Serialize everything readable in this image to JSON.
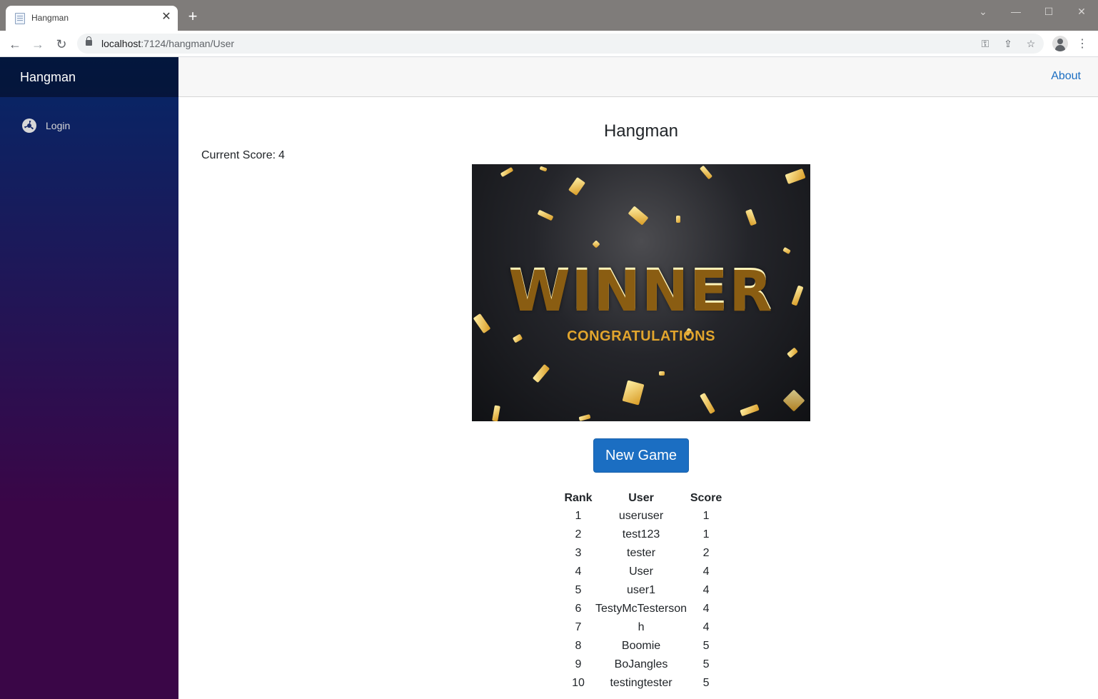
{
  "browser": {
    "tab_title": "Hangman",
    "url_host": "localhost",
    "url_path": ":7124/hangman/User",
    "icons": [
      "back-arrow-icon",
      "forward-arrow-icon",
      "reload-icon",
      "lock-icon",
      "key-icon",
      "share-icon",
      "star-icon",
      "profile-avatar-icon",
      "more-menu-icon"
    ]
  },
  "sidebar": {
    "brand": "Hangman",
    "items": [
      {
        "label": "Login",
        "icon": "login-icon"
      }
    ]
  },
  "top_row": {
    "about_label": "About"
  },
  "main": {
    "title": "Hangman",
    "score_label": "Current Score:",
    "score_value": "4",
    "image": {
      "headline": "WINNER",
      "subline": "CONGRATULATIONS"
    },
    "new_game_label": "New Game",
    "leaderboard": {
      "headers": [
        "Rank",
        "User",
        "Score"
      ],
      "rows": [
        [
          "1",
          "useruser",
          "1"
        ],
        [
          "2",
          "test123",
          "1"
        ],
        [
          "3",
          "tester",
          "2"
        ],
        [
          "4",
          "User",
          "4"
        ],
        [
          "5",
          "user1",
          "4"
        ],
        [
          "6",
          "TestyMcTesterson",
          "4"
        ],
        [
          "7",
          "h",
          "4"
        ],
        [
          "8",
          "Boomie",
          "5"
        ],
        [
          "9",
          "BoJangles",
          "5"
        ],
        [
          "10",
          "testingtester",
          "5"
        ]
      ]
    }
  },
  "colors": {
    "accent": "#1b6ec2",
    "sidebar_top": "#052767",
    "sidebar_bottom": "#3a0647",
    "confetti_gold": "#e2a52d"
  }
}
